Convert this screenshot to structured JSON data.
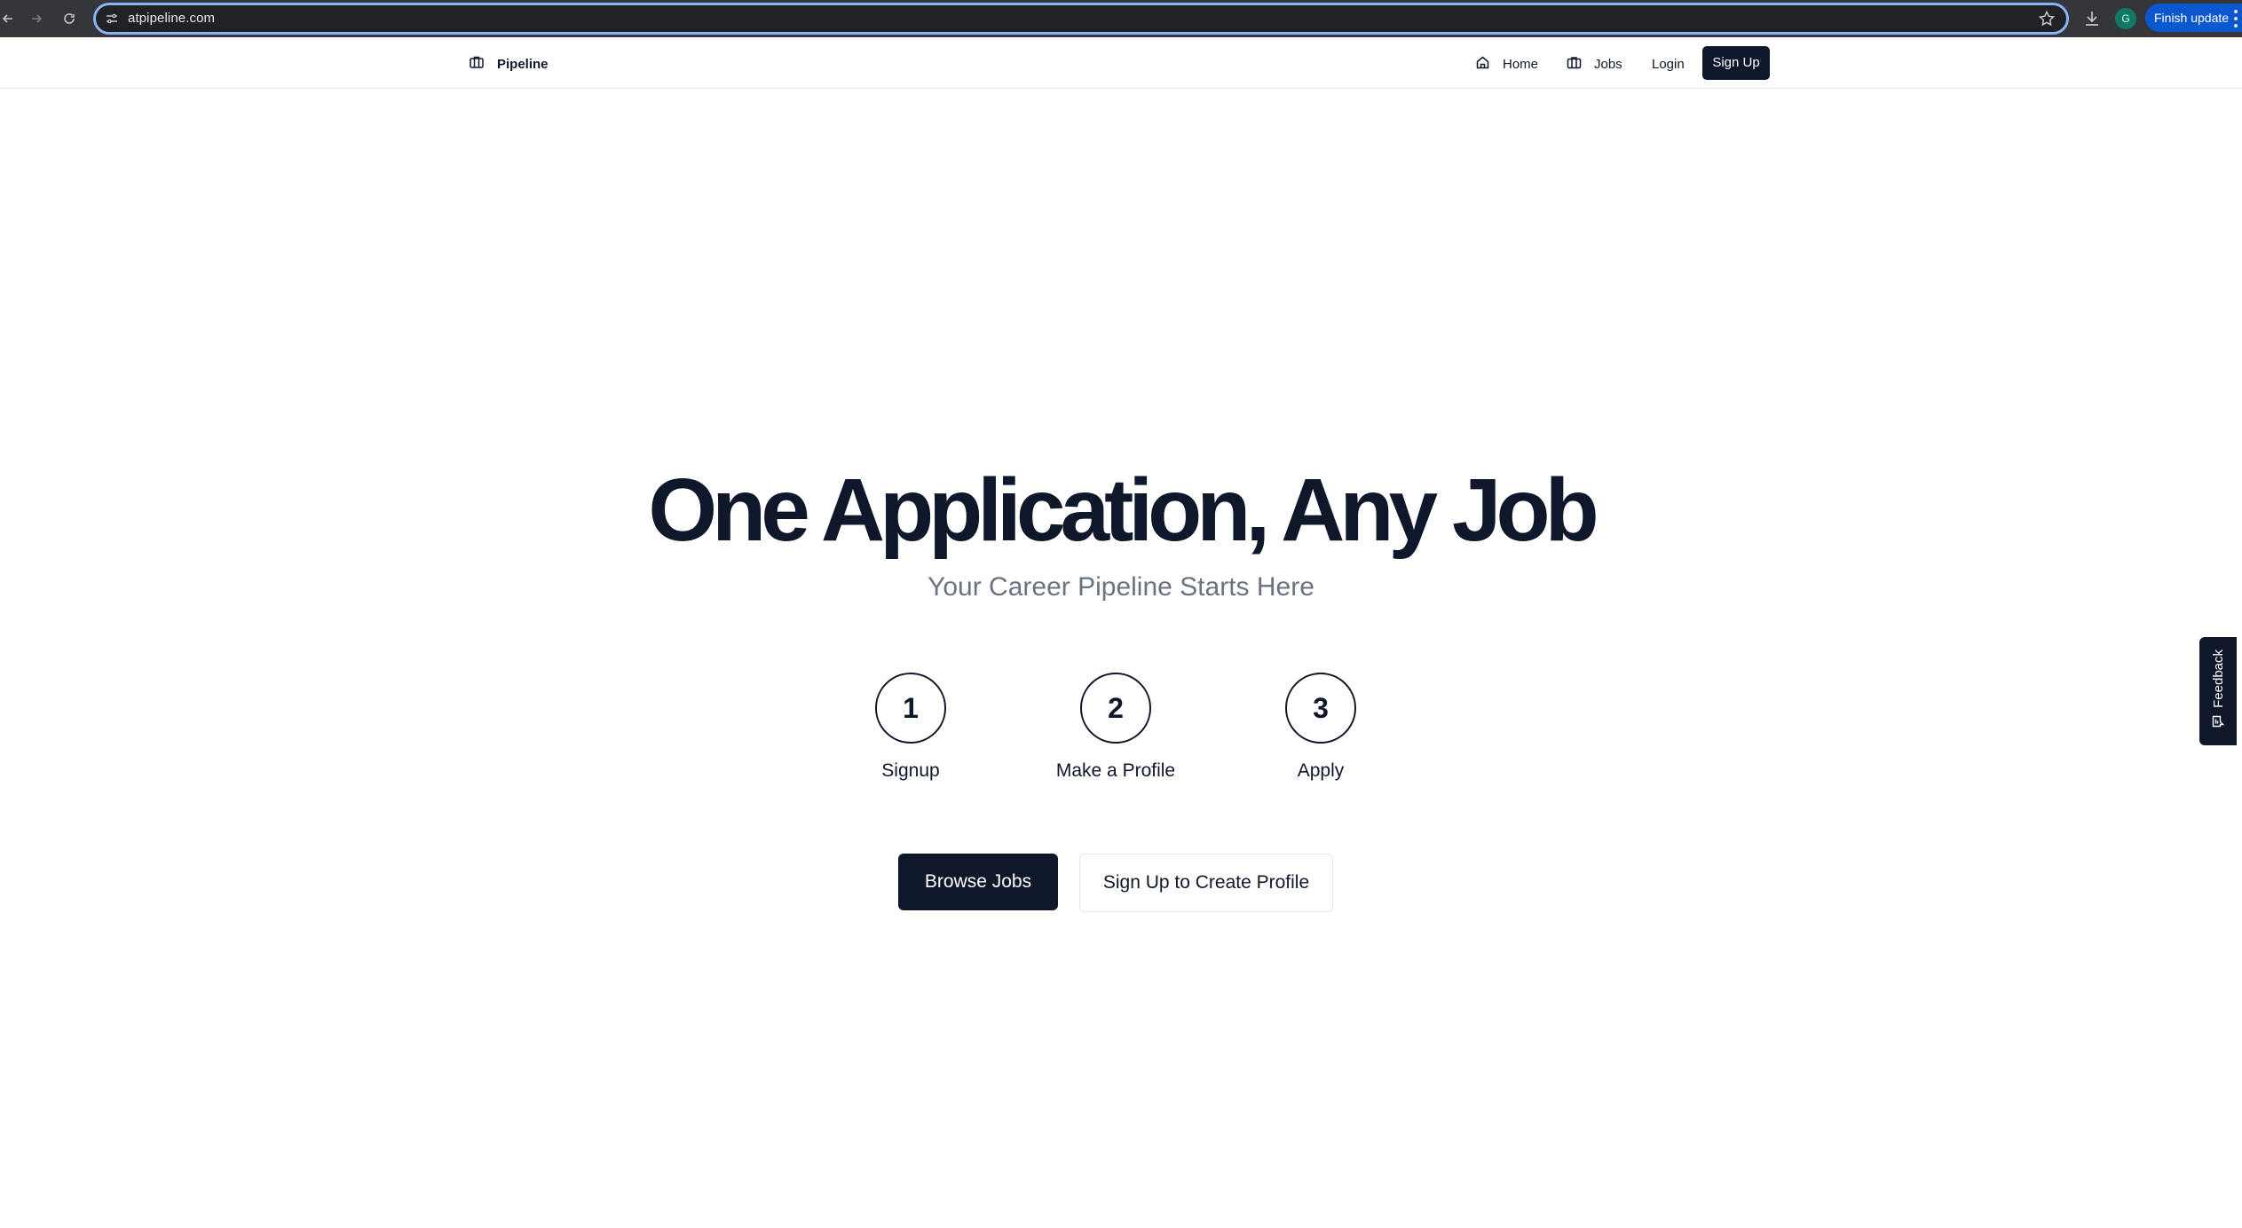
{
  "browser": {
    "url": "atpipeline.com",
    "profile_initial": "G",
    "update_label": "Finish update",
    "icons": [
      "back-icon",
      "forward-icon",
      "reload-icon",
      "site-settings-icon",
      "star-icon",
      "download-icon",
      "menu-icon"
    ]
  },
  "header": {
    "brand": "Pipeline",
    "nav": [
      {
        "label": "Home",
        "icon": "home-icon"
      },
      {
        "label": "Jobs",
        "icon": "briefcase-icon"
      },
      {
        "label": "Login"
      }
    ],
    "signup_label": "Sign Up"
  },
  "hero": {
    "title": "One Application, Any Job",
    "subtitle": "Your Career Pipeline Starts Here",
    "steps": [
      {
        "number": "1",
        "label": "Signup"
      },
      {
        "number": "2",
        "label": "Make a Profile"
      },
      {
        "number": "3",
        "label": "Apply"
      }
    ],
    "primary_cta": "Browse Jobs",
    "secondary_cta": "Sign Up to Create Profile"
  },
  "feedback": {
    "label": "Feedback",
    "icon": "message-icon"
  },
  "colors": {
    "primary": "#0f172a",
    "muted_text": "#6b7280",
    "border": "#e5e7eb",
    "chrome_update": "#0b57d0"
  }
}
